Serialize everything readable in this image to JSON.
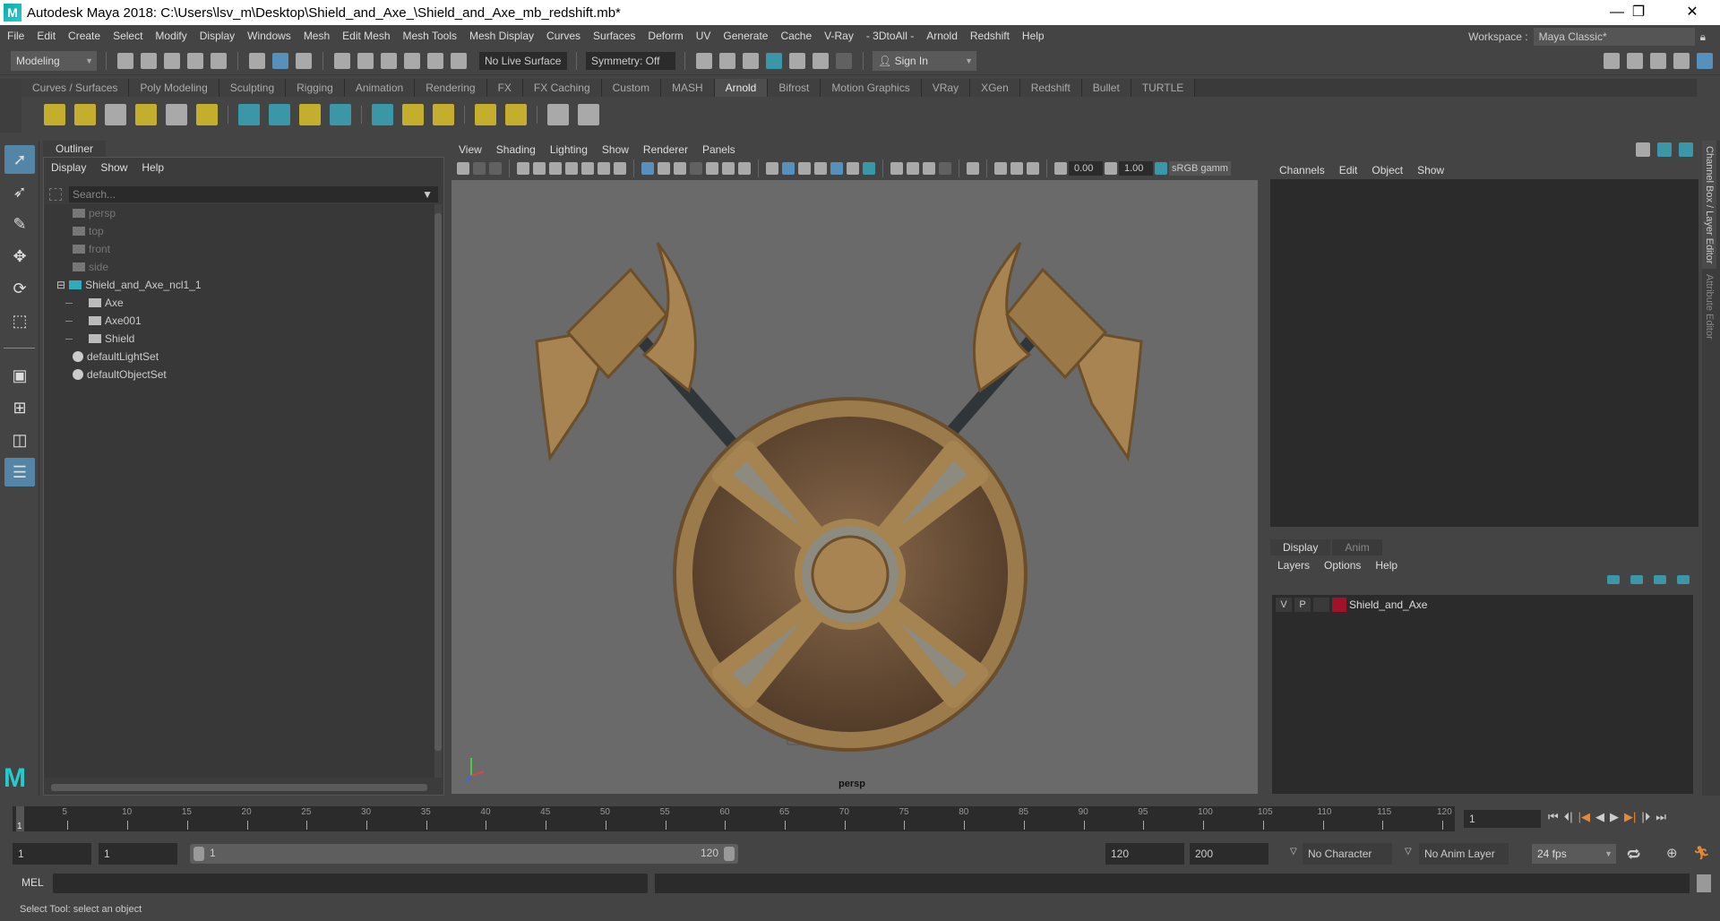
{
  "title": "Autodesk Maya 2018: C:\\Users\\lsv_m\\Desktop\\Shield_and_Axe_\\Shield_and_Axe_mb_redshift.mb*",
  "window_buttons": {
    "minimize": "—",
    "restore": "❐",
    "close": "✕"
  },
  "menu": [
    "File",
    "Edit",
    "Create",
    "Select",
    "Modify",
    "Display",
    "Windows",
    "Mesh",
    "Edit Mesh",
    "Mesh Tools",
    "Mesh Display",
    "Curves",
    "Surfaces",
    "Deform",
    "UV",
    "Generate",
    "Cache",
    "V-Ray",
    "- 3DtoAll -",
    "Arnold",
    "Redshift",
    "Help"
  ],
  "workspace": {
    "label": "Workspace :",
    "value": "Maya Classic*"
  },
  "status": {
    "mode": "Modeling",
    "live_surface": "No Live Surface",
    "symmetry": "Symmetry: Off",
    "sign_in": "Sign In"
  },
  "shelf_tabs": [
    "Curves / Surfaces",
    "Poly Modeling",
    "Sculpting",
    "Rigging",
    "Animation",
    "Rendering",
    "FX",
    "FX Caching",
    "Custom",
    "MASH",
    "Arnold",
    "Bifrost",
    "Motion Graphics",
    "VRay",
    "XGen",
    "Redshift",
    "Bullet",
    "TURTLE"
  ],
  "active_shelf": "Arnold",
  "outliner": {
    "title": "Outliner",
    "menu": [
      "Display",
      "Show",
      "Help"
    ],
    "search_placeholder": "Search...",
    "items": [
      {
        "label": "persp",
        "icon": "camera-icon",
        "indent": 1,
        "dim": true
      },
      {
        "label": "top",
        "icon": "camera-icon",
        "indent": 1,
        "dim": true
      },
      {
        "label": "front",
        "icon": "camera-icon",
        "indent": 1,
        "dim": true
      },
      {
        "label": "side",
        "icon": "camera-icon",
        "indent": 1,
        "dim": true
      },
      {
        "label": "Shield_and_Axe_ncl1_1",
        "icon": "group-icon",
        "indent": 0,
        "dim": false,
        "expanded": "⊟"
      },
      {
        "label": "Axe",
        "icon": "mesh-icon",
        "indent": 2,
        "dim": false
      },
      {
        "label": "Axe001",
        "icon": "mesh-icon",
        "indent": 2,
        "dim": false
      },
      {
        "label": "Shield",
        "icon": "mesh-icon",
        "indent": 2,
        "dim": false
      },
      {
        "label": "defaultLightSet",
        "icon": "set-icon",
        "indent": 1,
        "dim": false
      },
      {
        "label": "defaultObjectSet",
        "icon": "set-icon",
        "indent": 1,
        "dim": false
      }
    ]
  },
  "viewport": {
    "menu": [
      "View",
      "Shading",
      "Lighting",
      "Show",
      "Renderer",
      "Panels"
    ],
    "exposure": "0.00",
    "gamma": "1.00",
    "color_space": "sRGB gamm",
    "camera_label": "persp"
  },
  "channel_box": {
    "menu": [
      "Channels",
      "Edit",
      "Object",
      "Show"
    ]
  },
  "layer_editor": {
    "tabs": [
      "Display",
      "Anim"
    ],
    "menu": [
      "Layers",
      "Options",
      "Help"
    ],
    "layer": {
      "v": "V",
      "p": "P",
      "name": "Shield_and_Axe",
      "color": "#a0122a"
    }
  },
  "side_tabs": [
    "Channel Box / Layer Editor",
    "Attribute Editor"
  ],
  "timeline": {
    "start": 1,
    "end": 120,
    "current": 1,
    "current_field": "1",
    "labels": [
      5,
      10,
      15,
      20,
      25,
      30,
      35,
      40,
      45,
      50,
      55,
      60,
      65,
      70,
      75,
      80,
      85,
      90,
      95,
      100,
      105,
      110,
      115,
      120
    ]
  },
  "range": {
    "start_anim": "1",
    "start_play": "1",
    "slider_start": "1",
    "slider_end": "120",
    "end_play": "120",
    "end_anim": "200",
    "character_set": "No Character Set",
    "anim_layer": "No Anim Layer",
    "fps": "24 fps"
  },
  "command": {
    "label": "MEL"
  },
  "help_line": "Select Tool: select an object",
  "colors": {
    "accent": "#5285a6",
    "viewport_bg": "#6a6a6a",
    "panel_bg": "#444444"
  }
}
